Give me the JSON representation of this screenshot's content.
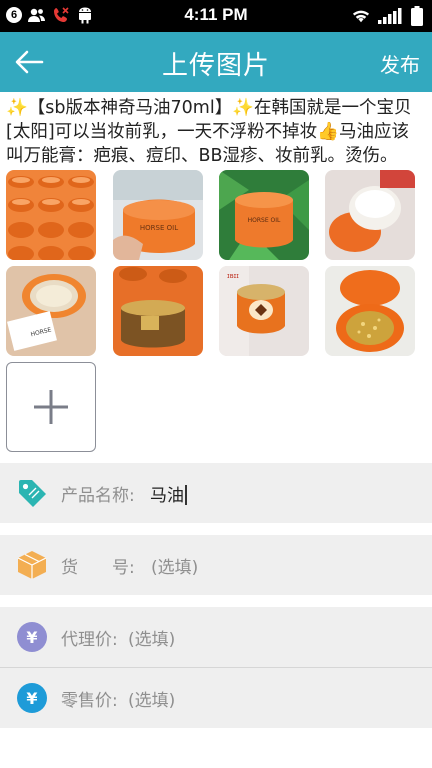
{
  "status_bar": {
    "notification_count": "6",
    "time": "4:11 PM"
  },
  "header": {
    "title": "上传图片",
    "publish_label": "发布",
    "background": "#33a9bf"
  },
  "description": "✨【sb版本神奇马油70ml】✨在韩国就是一个宝贝[太阳]可以当妆前乳，一天不浮粉不掉妆👍马油应该叫万能膏：疤痕、痘印、BB湿疹、妆前乳。烫伤。",
  "photos": [
    {
      "name": "photo-jars-rows",
      "bg": "#e8742a"
    },
    {
      "name": "photo-jar-in-hand",
      "bg": "#e97a2e"
    },
    {
      "name": "photo-jar-on-leaves",
      "bg": "#e97532"
    },
    {
      "name": "photo-open-jar-white",
      "bg": "#d9d3cf"
    },
    {
      "name": "photo-jar-with-card",
      "bg": "#cfa27a"
    },
    {
      "name": "photo-gold-jar",
      "bg": "#b9873f"
    },
    {
      "name": "photo-open-gold-jar",
      "bg": "#c9a24e"
    },
    {
      "name": "photo-jar-lid-gold",
      "bg": "#e0691f"
    }
  ],
  "form": {
    "product_name": {
      "label": "产品名称:",
      "value": "马油",
      "icon": "tag-icon",
      "color": "#2bb5b2"
    },
    "sku": {
      "label": "货　　号:",
      "placeholder": "(选填)",
      "icon": "box-icon",
      "color": "#f0a444"
    },
    "agent_price": {
      "label": "代理价:",
      "placeholder": "(选填)",
      "icon": "yen-icon",
      "color": "#8f8ed2"
    },
    "retail_price": {
      "label": "零售价:",
      "placeholder": "(选填)",
      "icon": "yen-icon",
      "color": "#1e9bd8"
    }
  }
}
